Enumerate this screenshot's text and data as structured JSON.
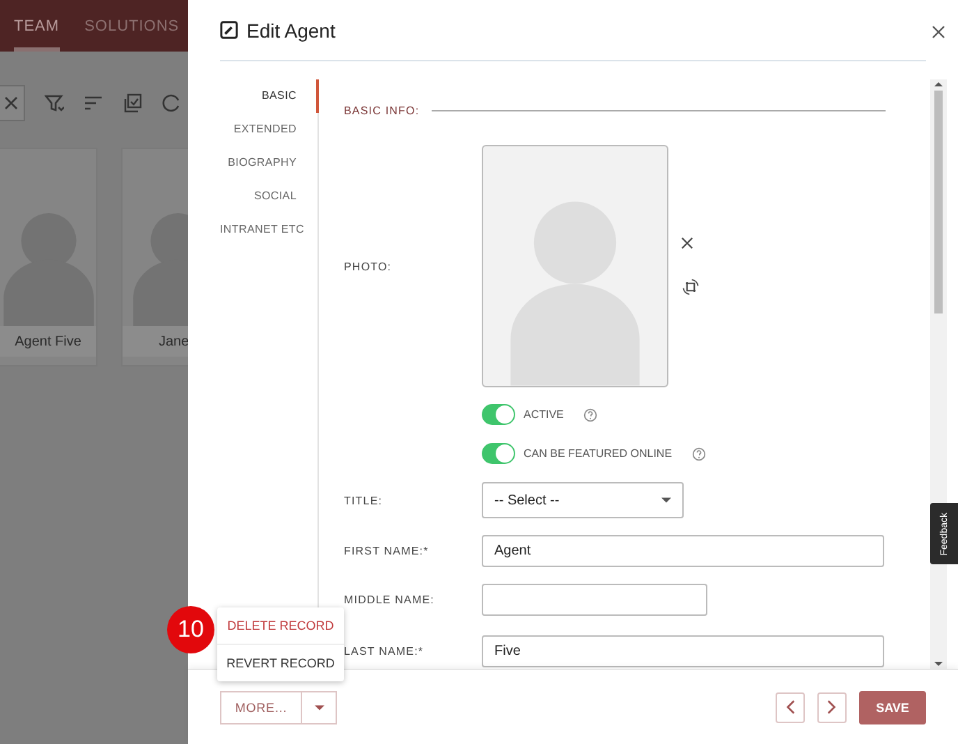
{
  "background": {
    "nav_tabs": [
      {
        "label": "TEAM",
        "selected": true
      },
      {
        "label": "SOLUTIONS",
        "selected": false
      }
    ],
    "cards": [
      {
        "name": "Agent Five"
      },
      {
        "name": "Jane"
      }
    ]
  },
  "dialog": {
    "title": "Edit Agent",
    "sections": [
      {
        "label": "BASIC",
        "selected": true
      },
      {
        "label": "EXTENDED",
        "selected": false
      },
      {
        "label": "BIOGRAPHY",
        "selected": false
      },
      {
        "label": "SOCIAL",
        "selected": false
      },
      {
        "label": "INTRANET ETC",
        "selected": false
      }
    ],
    "section_heading": "BASIC INFO:",
    "photo_label": "PHOTO:",
    "toggles": [
      {
        "label": "ACTIVE",
        "on": true
      },
      {
        "label": "CAN BE FEATURED ONLINE",
        "on": true
      }
    ],
    "fields": [
      {
        "label": "TITLE:",
        "kind": "select",
        "value": "-- Select --"
      },
      {
        "label": "FIRST NAME:*",
        "kind": "text",
        "value": "Agent"
      },
      {
        "label": "MIDDLE NAME:",
        "kind": "text"
      },
      {
        "label": "LAST NAME:*",
        "kind": "text",
        "value": "Five"
      }
    ],
    "more_button": "MORE...",
    "save_button": "SAVE"
  },
  "menu": [
    {
      "label": "DELETE RECORD",
      "kind": "danger"
    },
    {
      "label": "REVERT RECORD",
      "kind": "normal"
    }
  ],
  "step_badge": "10",
  "feedback": "Feedback"
}
